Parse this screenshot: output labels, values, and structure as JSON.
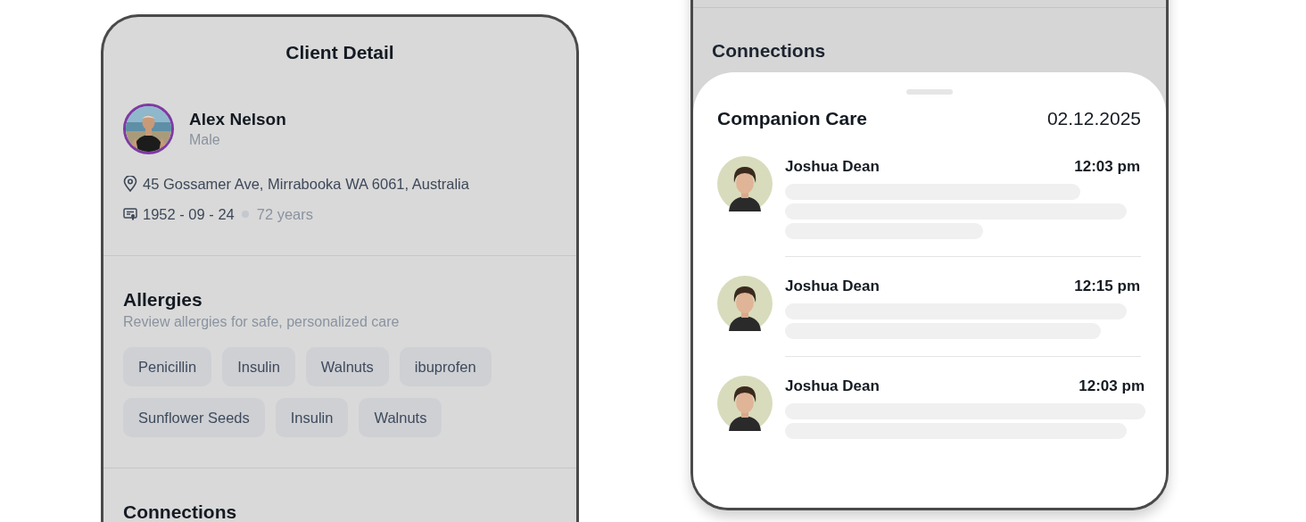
{
  "left_screen": {
    "title": "Client Detail",
    "client": {
      "name": "Alex Nelson",
      "gender": "Male",
      "address": "45 Gossamer Ave, Mirrabooka WA 6061, Australia",
      "birth_date": "1952 - 09 - 24",
      "age": "72 years"
    },
    "allergies": {
      "title": "Allergies",
      "subtitle": "Review allergies for safe, personalized care",
      "tags": [
        "Penicillin",
        "Insulin",
        "Walnuts",
        "ibuprofen",
        "Sunflower Seeds",
        "Insulin",
        "Walnuts"
      ]
    },
    "connections": {
      "title": "Connections"
    }
  },
  "right_screen": {
    "connections": {
      "title": "Connections"
    },
    "sheet": {
      "title": "Companion Care",
      "date": "02.12.2025",
      "entries": [
        {
          "name": "Joshua Dean",
          "time": "12:03 pm",
          "preview_lines": [
            {
              "kind": "medium"
            },
            {
              "kind": "longer"
            },
            {
              "kind": "short"
            }
          ]
        },
        {
          "name": "Joshua Dean",
          "time": "12:15 pm",
          "preview_lines": [
            {
              "kind": "longer"
            },
            {
              "kind": "long"
            }
          ]
        },
        {
          "name": "Joshua Dean",
          "time": "12:03 pm",
          "preview_lines": [
            {
              "kind": "full"
            },
            {
              "kind": "longer"
            }
          ]
        }
      ]
    }
  }
}
